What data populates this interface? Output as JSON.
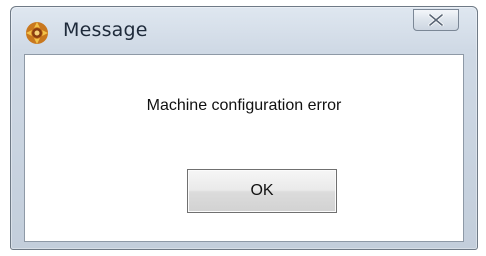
{
  "window": {
    "title": "Message",
    "icon": "app-logo-icon",
    "close_icon": "close-icon"
  },
  "dialog": {
    "message": "Machine configuration error",
    "ok_label": "OK"
  },
  "colors": {
    "frame": "#c3cedb",
    "client": "#ffffff",
    "title_text": "#1e2a3a"
  }
}
